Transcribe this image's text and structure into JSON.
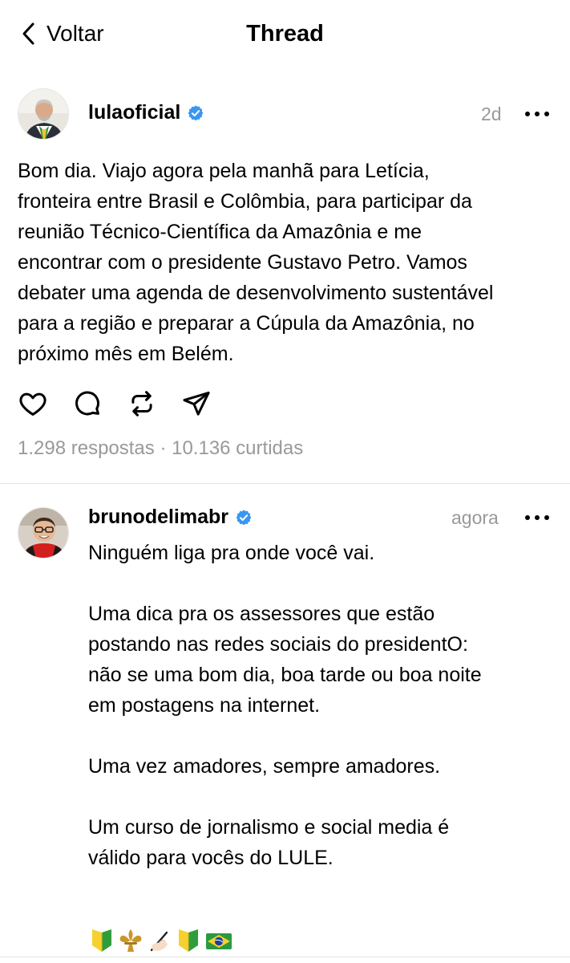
{
  "header": {
    "back_label": "Voltar",
    "title": "Thread"
  },
  "post": {
    "username": "lulaoficial",
    "time": "2d",
    "text": "Bom dia. Viajo agora pela manhã para Letícia,\nfronteira entre Brasil e Colômbia, para participar da\nreunião Técnico-Científica da Amazônia e me\nencontrar com o presidente Gustavo Petro. Vamos\ndebater uma agenda de desenvolvimento sustentável\npara a região e preparar a Cúpula da Amazônia, no\npróximo mês em Belém.",
    "stats": "1.298 respostas · 10.136 curtidas",
    "actions": [
      "heart-icon",
      "comment-icon",
      "repost-icon",
      "share-icon"
    ]
  },
  "reply": {
    "username": "brunodelimabr",
    "time": "agora",
    "text": "Ninguém liga pra onde você vai.\n\nUma dica pra os assessores que estão\npostando nas redes sociais do presidentO:\nnão se uma bom dia, boa tarde ou boa noite\nem postagens na internet.\n\nUma vez amadores, sempre amadores.\n\nUm curso de jornalismo e social media é\nválido para vocês do LULE.",
    "emojis": [
      "beginner-symbol-icon",
      "fleur-de-lis-icon",
      "writing-hand-icon",
      "beginner-symbol-icon",
      "brazil-flag-icon"
    ]
  },
  "colors": {
    "verified_badge": "#3897f0",
    "muted_text": "#999999",
    "divider": "#e3e3e3"
  }
}
